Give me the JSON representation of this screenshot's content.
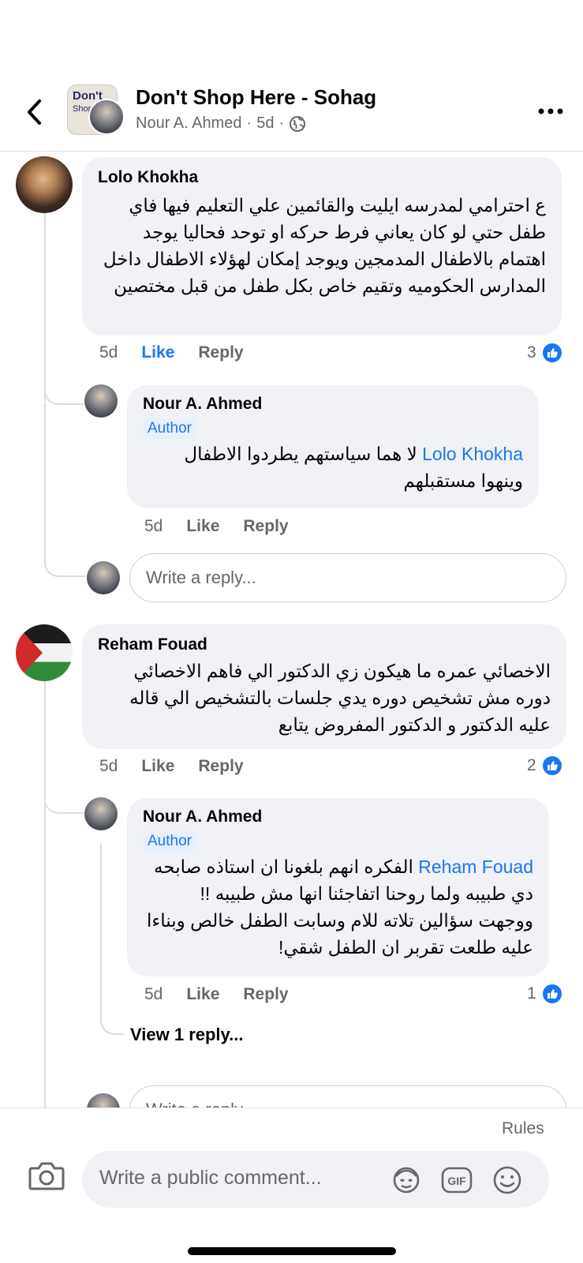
{
  "header": {
    "title": "Don't Shop Here - Sohag",
    "author": "Nour A. Ahmed",
    "time": "5d",
    "separator": "·",
    "thumb_text": "Don't",
    "thumb_sub": "Shop"
  },
  "comments": [
    {
      "name": "Lolo Khokha",
      "text": "ع احترامي لمدرسه ايليت والقائمين علي التعليم فيها فاي طفل حتي لو كان يعاني فرط حركه او توحد فحاليا يوجد اهتمام بالاطفال المدمجين ويوجد إمكان لهؤلاء الاطفال داخل المدارس الحكوميه وتقيم خاص بكل طفل من قبل مختصين",
      "time": "5d",
      "like": "Like",
      "reply": "Reply",
      "reactions": "3",
      "reply_item": {
        "name": "Nour A. Ahmed",
        "badge": "Author",
        "mention": "Lolo Khokha",
        "text": "لا هما سياستهم يطردوا الاطفال وينهوا مستقبلهم",
        "time": "5d",
        "like": "Like",
        "reply": "Reply"
      },
      "reply_placeholder": "Write a reply..."
    },
    {
      "name": "Reham Fouad",
      "text": "الاخصائي عمره ما هيكون زي الدكتور الي فاهم الاخصائي دوره مش تشخيص دوره يدي جلسات بالتشخيص الي قاله عليه الدكتور و الدكتور المفروض يتابع",
      "time": "5d",
      "like": "Like",
      "reply": "Reply",
      "reactions": "2",
      "reply_item": {
        "name": "Nour A. Ahmed",
        "badge": "Author",
        "mention": "Reham Fouad",
        "text": "الفكره انهم بلغونا ان استاذه صابحه دي طبيبه ولما روحنا اتفاجئنا انها مش طبيبه !! ووجهت سؤالين تلاته للام وسابت الطفل خالص وبناءا عليه طلعت تقربر ان الطفل شقي!",
        "time": "5d",
        "like": "Like",
        "reply": "Reply",
        "reactions": "1"
      },
      "view_replies": "View 1 reply...",
      "reply_placeholder": "Write a reply..."
    }
  ],
  "footer": {
    "rules": "Rules",
    "comment_placeholder": "Write a public comment..."
  },
  "colors": {
    "accent": "#1877f2",
    "bubble": "#f0f2f5",
    "secondary_text": "#65676b"
  },
  "icons": [
    "back-arrow-icon",
    "globe-icon",
    "more-icon",
    "camera-icon",
    "avatar-sticker-icon",
    "gif-icon",
    "emoji-icon",
    "like-reaction-icon"
  ]
}
